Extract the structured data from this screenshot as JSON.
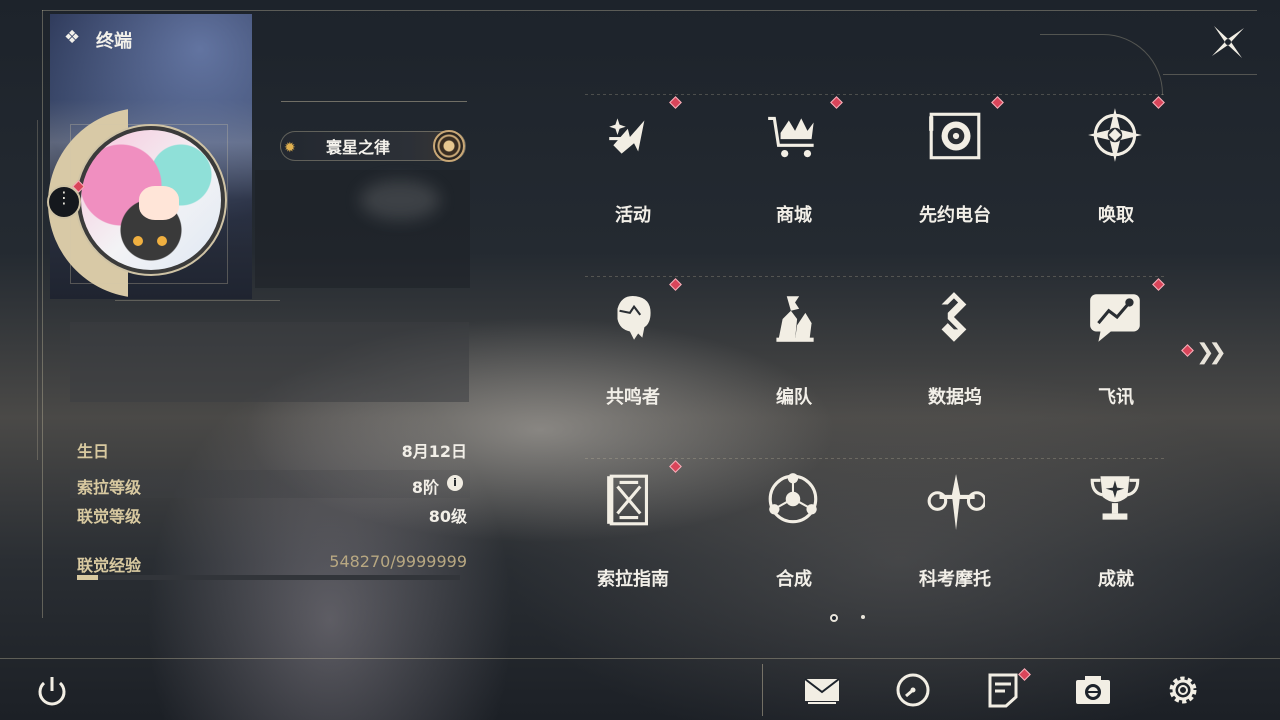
{
  "header": {
    "title": "终端"
  },
  "profile": {
    "name": "寰星之律",
    "birthday_label": "生日",
    "birthday_value": "8月12日",
    "sola_level_label": "索拉等级",
    "sola_level_value": "8阶",
    "union_level_label": "联觉等级",
    "union_level_value": "80级",
    "union_exp_label": "联觉经验",
    "union_exp_value": "548270/9999999",
    "union_exp_fraction": 0.0548
  },
  "menu": {
    "items": [
      {
        "label": "活动",
        "icon": "activity-icon",
        "badge": true
      },
      {
        "label": "商城",
        "icon": "shop-cart-icon",
        "badge": true
      },
      {
        "label": "先约电台",
        "icon": "radio-icon",
        "badge": true
      },
      {
        "label": "唤取",
        "icon": "compass-star-icon",
        "badge": true
      },
      {
        "label": "共鸣者",
        "icon": "resonator-head-icon",
        "badge": true
      },
      {
        "label": "编队",
        "icon": "chess-team-icon",
        "badge": false
      },
      {
        "label": "数据坞",
        "icon": "data-dock-icon",
        "badge": false
      },
      {
        "label": "飞讯",
        "icon": "message-bubble-icon",
        "badge": true
      },
      {
        "label": "索拉指南",
        "icon": "guide-book-icon",
        "badge": true
      },
      {
        "label": "合成",
        "icon": "synthesis-icon",
        "badge": false
      },
      {
        "label": "科考摩托",
        "icon": "motorcycle-icon",
        "badge": false
      },
      {
        "label": "成就",
        "icon": "trophy-icon",
        "badge": false
      }
    ],
    "current_page": 1,
    "total_pages": 2
  },
  "bottom_bar": {
    "icons": [
      "power-icon",
      "mail-icon",
      "clock-icon",
      "notes-icon",
      "camera-icon",
      "settings-gear-icon"
    ]
  },
  "colors": {
    "badge_red": "#d9455a",
    "accent_gold": "#d8c9a0"
  }
}
